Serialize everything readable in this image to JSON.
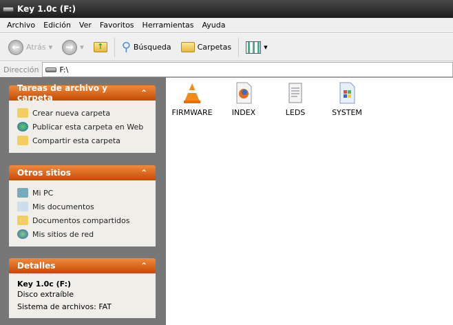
{
  "window": {
    "title": "Key 1.0c (F:)"
  },
  "menu": [
    "Archivo",
    "Edición",
    "Ver",
    "Favoritos",
    "Herramientas",
    "Ayuda"
  ],
  "toolbar": {
    "back": "Atrás",
    "search": "Búsqueda",
    "folders": "Carpetas"
  },
  "address": {
    "label": "Dirección",
    "value": "F:\\"
  },
  "panels": {
    "tasks": {
      "title": "Tareas de archivo y carpeta",
      "items": [
        "Crear nueva carpeta",
        "Publicar esta carpeta en Web",
        "Compartir esta carpeta"
      ]
    },
    "places": {
      "title": "Otros sitios",
      "items": [
        "Mi PC",
        "Mis documentos",
        "Documentos compartidos",
        "Mis sitios de red"
      ]
    },
    "details": {
      "title": "Detalles",
      "name": "Key 1.0c (F:)",
      "type": "Disco extraíble",
      "fs": "Sistema de archivos: FAT"
    }
  },
  "files": [
    "FIRMWARE",
    "INDEX",
    "LEDS",
    "SYSTEM"
  ],
  "collapse": "⌃"
}
